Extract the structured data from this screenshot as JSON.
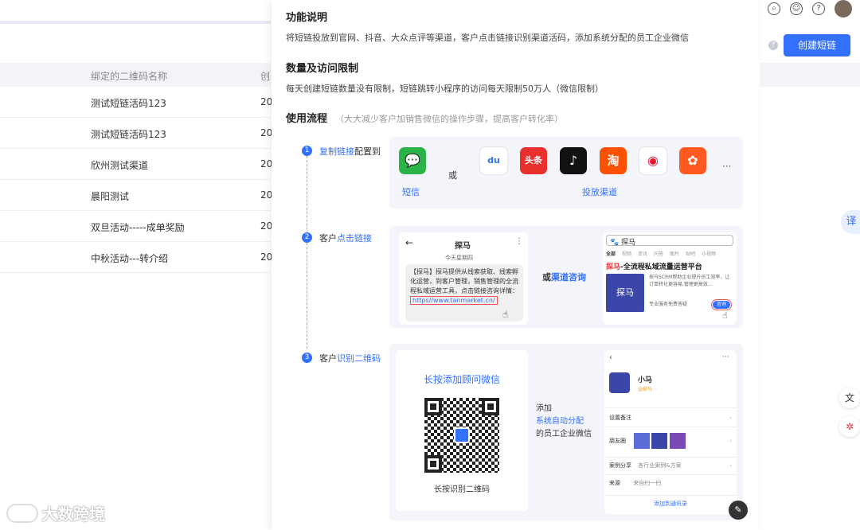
{
  "colors": {
    "accent": "#3370ff",
    "panel_bg": "#ffffff",
    "card_bg": "#f3f5fb"
  },
  "topbar": {
    "icons": [
      "search-icon",
      "message-icon",
      "help-icon",
      "user-avatar"
    ]
  },
  "page": {
    "create_button": "创建短链",
    "help_icon": "?",
    "table": {
      "headers": [
        "绑定的二维码名称",
        "创"
      ],
      "rows": [
        {
          "name": "测试短链活码123",
          "date": "20"
        },
        {
          "name": "测试短链活码123",
          "date": "20"
        },
        {
          "name": "欣州测试渠道",
          "date": "20"
        },
        {
          "name": "晨阳测试",
          "date": "20"
        },
        {
          "name": "双旦活动-----成单奖励",
          "date": "20"
        },
        {
          "name": "中秋活动---转介绍",
          "date": "20"
        }
      ]
    },
    "side_translate": "译",
    "watermark_logo": "大数跨境"
  },
  "panel": {
    "feature_title": "功能说明",
    "feature_text": "将短链投放到官网、抖音、大众点评等渠道，客户点击链接识别渠道活码，添加系统分配的员工企业微信",
    "limit_title": "数量及访问限制",
    "limit_text": "每天创建短链数量没有限制，短链跳转小程序的访问每天限制50万人（微信限制）",
    "flow_title": "使用流程",
    "flow_sub": "（大大减少客户加销售微信的操作步骤，提高客户转化率）",
    "steps": [
      {
        "num": "1",
        "prefix": "",
        "highlight": "复制链接",
        "suffix": "配置到"
      },
      {
        "num": "2",
        "prefix": "客户",
        "highlight": "点击链接",
        "suffix": ""
      },
      {
        "num": "3",
        "prefix": "客户",
        "highlight": "识别二维码",
        "suffix": ""
      }
    ],
    "step1": {
      "or": "或",
      "sms_label": "短信",
      "channel_label": "投放渠道",
      "app_icons": [
        {
          "name": "wechat-sms-icon",
          "glyph": "💬",
          "color": "#2bb34a"
        },
        {
          "name": "baidu-icon",
          "glyph": "du",
          "color": "#ffffff"
        },
        {
          "name": "toutiao-icon",
          "glyph": "头条",
          "color": "#e9302d"
        },
        {
          "name": "tiktok-icon",
          "glyph": "♪",
          "color": "#111111"
        },
        {
          "name": "taobao-icon",
          "glyph": "淘",
          "color": "#ff5000"
        },
        {
          "name": "weibo-icon",
          "glyph": "◉",
          "color": "#ffffff"
        },
        {
          "name": "xiaohongshu-icon",
          "glyph": "✿",
          "color": "#ff5a1f"
        }
      ],
      "more": "···"
    },
    "step2": {
      "phone_title": "探马",
      "phone_date": "今天星期四",
      "msg_text": "【探马】探马提供从线索获取、线索孵化运营，到客户管理，销售管理的全流程私域运营工具，点击链接咨询详情：",
      "msg_link": "https//www.tanmarket.cn/",
      "or_channel_prefix": "或",
      "or_channel_highlight": "渠道咨询",
      "search_text": "探马",
      "tabs": [
        "全部",
        "视频",
        "资讯",
        "问答",
        "图片",
        "贴吧",
        "小视频"
      ],
      "result_title_brand": "探马",
      "result_title_rest": "-全流程私域流量运营平台",
      "result_logo": "探马",
      "result_desc": "探马SCRM帮助企业提升员工效率，让订单转化更容易,管理更高效...",
      "result_tag": "专业服务免费答疑",
      "ask_btn": "咨询"
    },
    "step3": {
      "qr_title": "长按添加顾问微信",
      "qr_caption": "长按识别二维码",
      "add_text_1": "添加",
      "add_text_2": "系统自动分配",
      "add_text_3": "的员工企业微信",
      "profile_name": "小马",
      "profile_sub": "@探马",
      "rows": [
        "设置备注",
        "朋友圈",
        "案例分享",
        "来源"
      ],
      "case_value": "各行业案例&方案",
      "source_value": "来自扫一扫",
      "add_contact": "添加到通讯录"
    }
  }
}
